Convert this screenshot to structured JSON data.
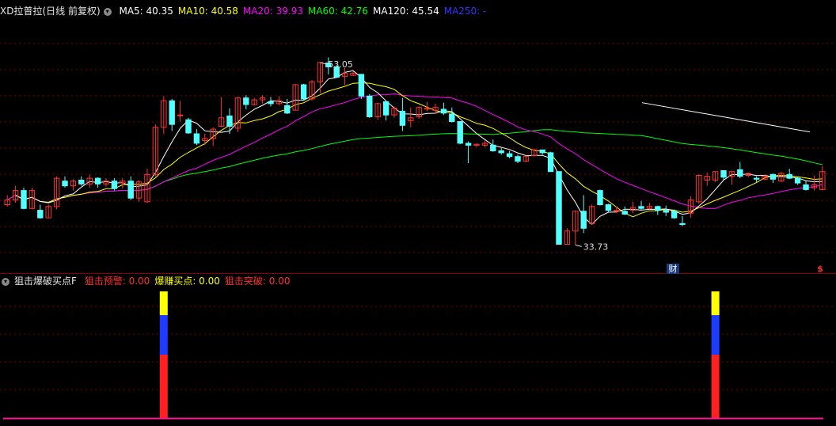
{
  "main_header": {
    "stock": "XD拉普拉(日线 前复权)",
    "collapse_icon": "chevron-down-icon",
    "ma": [
      {
        "label": "MA5: 40.35",
        "color": "#ffffff"
      },
      {
        "label": "MA10: 40.58",
        "color": "#ffff00"
      },
      {
        "label": "MA20: 39.93",
        "color": "#ff00ff"
      },
      {
        "label": "MA60: 42.76",
        "color": "#00ff00"
      },
      {
        "label": "MA120: 45.54",
        "color": "#ffffff"
      },
      {
        "label": "MA250: -",
        "color": "#3333ff"
      }
    ]
  },
  "indicator_header": {
    "name": "狙击爆破买点F",
    "items": [
      {
        "label": "狙击预警: 0.00",
        "color": "#ff3030"
      },
      {
        "label": "爆赚买点: 0.00",
        "color": "#ffff00"
      },
      {
        "label": "狙击突破: 0.00",
        "color": "#ff3030"
      }
    ]
  },
  "markers": {
    "high_label": "53.05",
    "low_label": "33.73",
    "finance_badge": "财",
    "dividend_badge": "$"
  },
  "colors": {
    "up": "#ff3232",
    "down": "#54ffff",
    "grid": "#7a0000",
    "ma5": "#ffffff",
    "ma10": "#ffff00",
    "ma20": "#ff00ff",
    "ma60": "#00ff00",
    "ma120": "#ffffff"
  },
  "chart_data": [
    {
      "type": "candlestick",
      "ylim": [
        32,
        58
      ],
      "ohlc": [
        [
          38,
          39,
          37.8,
          38.5
        ],
        [
          38.5,
          40,
          38.2,
          39.5
        ],
        [
          39.5,
          39.8,
          37.5,
          37.6
        ],
        [
          37.6,
          39.8,
          37.5,
          39.5
        ],
        [
          37.4,
          38,
          36.5,
          36.6
        ],
        [
          36.6,
          38,
          36.6,
          37.8
        ],
        [
          37.8,
          41,
          37.5,
          40.8
        ],
        [
          40.5,
          41,
          39.8,
          40
        ],
        [
          40,
          40.7,
          39.5,
          40.5
        ],
        [
          40.6,
          41,
          40,
          40.2
        ],
        [
          40.2,
          41.2,
          39.8,
          40.8
        ],
        [
          40.8,
          40.9,
          39.8,
          40.2
        ],
        [
          40.2,
          40.8,
          39.9,
          40.5
        ],
        [
          40.5,
          40.8,
          39.5,
          39.7
        ],
        [
          40.3,
          40.8,
          39.7,
          40.5
        ],
        [
          40.5,
          41,
          38.5,
          38.7
        ],
        [
          38.7,
          40.6,
          38.3,
          40.4
        ],
        [
          38.3,
          41.8,
          38.2,
          41.2
        ],
        [
          41.2,
          46.5,
          41,
          46.2
        ],
        [
          46.2,
          49.5,
          45.5,
          49
        ],
        [
          49,
          49.2,
          45.8,
          46.5
        ],
        [
          47.5,
          49,
          46.8,
          47.5
        ],
        [
          47,
          47.2,
          45.5,
          45.6
        ],
        [
          45.5,
          46,
          44.3,
          44.5
        ],
        [
          44.8,
          45.5,
          44.3,
          45
        ],
        [
          45,
          46.2,
          44.2,
          46
        ],
        [
          46.3,
          49.4,
          46.2,
          47.2
        ],
        [
          47.4,
          48.2,
          45.5,
          46.3
        ],
        [
          46.1,
          49.4,
          45.7,
          49.3
        ],
        [
          49.3,
          49.6,
          48.1,
          48.6
        ],
        [
          48.6,
          49.3,
          48.5,
          49.1
        ],
        [
          49.1,
          49.6,
          48.7,
          49.3
        ],
        [
          48.9,
          49.4,
          48.4,
          48.7
        ],
        [
          48.7,
          49.5,
          48.5,
          49
        ],
        [
          48.5,
          49.2,
          47.6,
          47.7
        ],
        [
          48,
          50.8,
          48,
          50.7
        ],
        [
          50.7,
          50.8,
          49.1,
          49.2
        ],
        [
          49.2,
          51.2,
          49,
          51
        ],
        [
          51,
          53.05,
          49.8,
          53.05
        ],
        [
          53,
          53.6,
          51.8,
          52.6
        ],
        [
          52.6,
          52.8,
          51.4,
          51.5
        ],
        [
          51.6,
          52.5,
          50.7,
          51.9
        ],
        [
          51.7,
          52.1,
          51.6,
          51.9
        ],
        [
          51.8,
          51.8,
          49.2,
          49.5
        ],
        [
          49.5,
          49.7,
          47.2,
          47.3
        ],
        [
          47.3,
          48.8,
          47,
          48.7
        ],
        [
          48.9,
          48.9,
          46.9,
          47.5
        ],
        [
          47.5,
          48.4,
          47.2,
          48.2
        ],
        [
          47.9,
          49.3,
          45.8,
          46.4
        ],
        [
          46.9,
          48.3,
          46.2,
          47.2
        ],
        [
          47.3,
          48.4,
          47.1,
          48.3
        ],
        [
          48.2,
          48.9,
          47.9,
          48.2
        ],
        [
          48,
          48.7,
          47.6,
          48.3
        ],
        [
          48.1,
          48.8,
          47.5,
          47.7
        ],
        [
          47.6,
          48.3,
          46.7,
          46.8
        ],
        [
          46.8,
          46.8,
          44.4,
          44.5
        ],
        [
          44.5,
          44.7,
          42.4,
          44.3
        ],
        [
          44.3,
          44.5,
          44.1,
          44.4
        ],
        [
          44.3,
          44.8,
          44.1,
          44.5
        ],
        [
          44.3,
          44.9,
          43.6,
          43.7
        ],
        [
          43.7,
          44,
          43.3,
          43.5
        ],
        [
          43.4,
          43.7,
          42.9,
          43.1
        ],
        [
          43.1,
          43.3,
          42.4,
          42.6
        ],
        [
          42.6,
          43.2,
          42.5,
          43.1
        ],
        [
          43.2,
          43.9,
          43.1,
          43.8
        ],
        [
          43.8,
          43.8,
          43.3,
          43.5
        ],
        [
          43.5,
          43.6,
          41.5,
          41.5
        ],
        [
          41.5,
          41.5,
          33.8,
          33.8
        ],
        [
          33.8,
          35.5,
          33.8,
          35.2
        ],
        [
          35.2,
          37.4,
          33.73,
          37.3
        ],
        [
          37.3,
          39,
          35,
          35.5
        ],
        [
          36,
          38,
          35.9,
          37.8
        ],
        [
          39.5,
          39.6,
          37.9,
          38
        ],
        [
          38,
          38.1,
          37.2,
          37.4
        ],
        [
          37.3,
          37.8,
          37.1,
          37.4
        ],
        [
          37.3,
          37.8,
          36.9,
          37
        ],
        [
          37.4,
          38.3,
          37.1,
          37.7
        ],
        [
          37.8,
          38.4,
          37.4,
          37.6
        ],
        [
          37.6,
          38.2,
          37.5,
          37.8
        ],
        [
          37.8,
          37.9,
          36.9,
          37.4
        ],
        [
          37.4,
          37.9,
          36.8,
          37.2
        ],
        [
          37.3,
          37.5,
          36.5,
          36.6
        ],
        [
          36,
          36.8,
          35.7,
          35.9
        ],
        [
          37.1,
          38.9,
          36.6,
          38.5
        ],
        [
          38.3,
          41.2,
          38.1,
          41.1
        ],
        [
          40.6,
          41.4,
          40,
          41
        ],
        [
          40.6,
          41.5,
          40.4,
          41.5
        ],
        [
          41.6,
          41.6,
          40.6,
          40.9
        ],
        [
          41,
          41.6,
          40.1,
          41.5
        ],
        [
          41.7,
          42.5,
          40.8,
          41
        ],
        [
          41.1,
          41.4,
          40.9,
          41.3
        ],
        [
          40.8,
          41,
          40.3,
          40.7
        ],
        [
          40.7,
          41.2,
          40.6,
          41
        ],
        [
          41.2,
          41.3,
          40.3,
          40.7
        ],
        [
          40.5,
          41.5,
          40.4,
          41.3
        ],
        [
          41.2,
          41.8,
          40.7,
          40.8
        ],
        [
          40.8,
          40.9,
          40.1,
          40.3
        ],
        [
          40.1,
          40.5,
          39.5,
          39.6
        ],
        [
          39.8,
          41.1,
          39.5,
          40.1
        ],
        [
          39.6,
          42.1,
          39.5,
          41.5
        ]
      ],
      "ma120": [
        [
          0.776,
          48.8
        ],
        [
          0.98,
          45.7
        ]
      ],
      "annotations": [
        "53.05",
        "33.73"
      ]
    },
    {
      "type": "bar",
      "title": "狙击爆破买点F",
      "bars": [
        {
          "index": 19,
          "segments": [
            {
              "value": 0.4,
              "color": "#ff2020"
            },
            {
              "value": 0.25,
              "color": "#1e3cff"
            },
            {
              "value": 0.15,
              "color": "#ffff00"
            }
          ]
        },
        {
          "index": 86,
          "segments": [
            {
              "value": 0.4,
              "color": "#ff2020"
            },
            {
              "value": 0.25,
              "color": "#1e3cff"
            },
            {
              "value": 0.15,
              "color": "#ffff00"
            }
          ]
        }
      ],
      "baseline_color": "#ff1493"
    }
  ]
}
